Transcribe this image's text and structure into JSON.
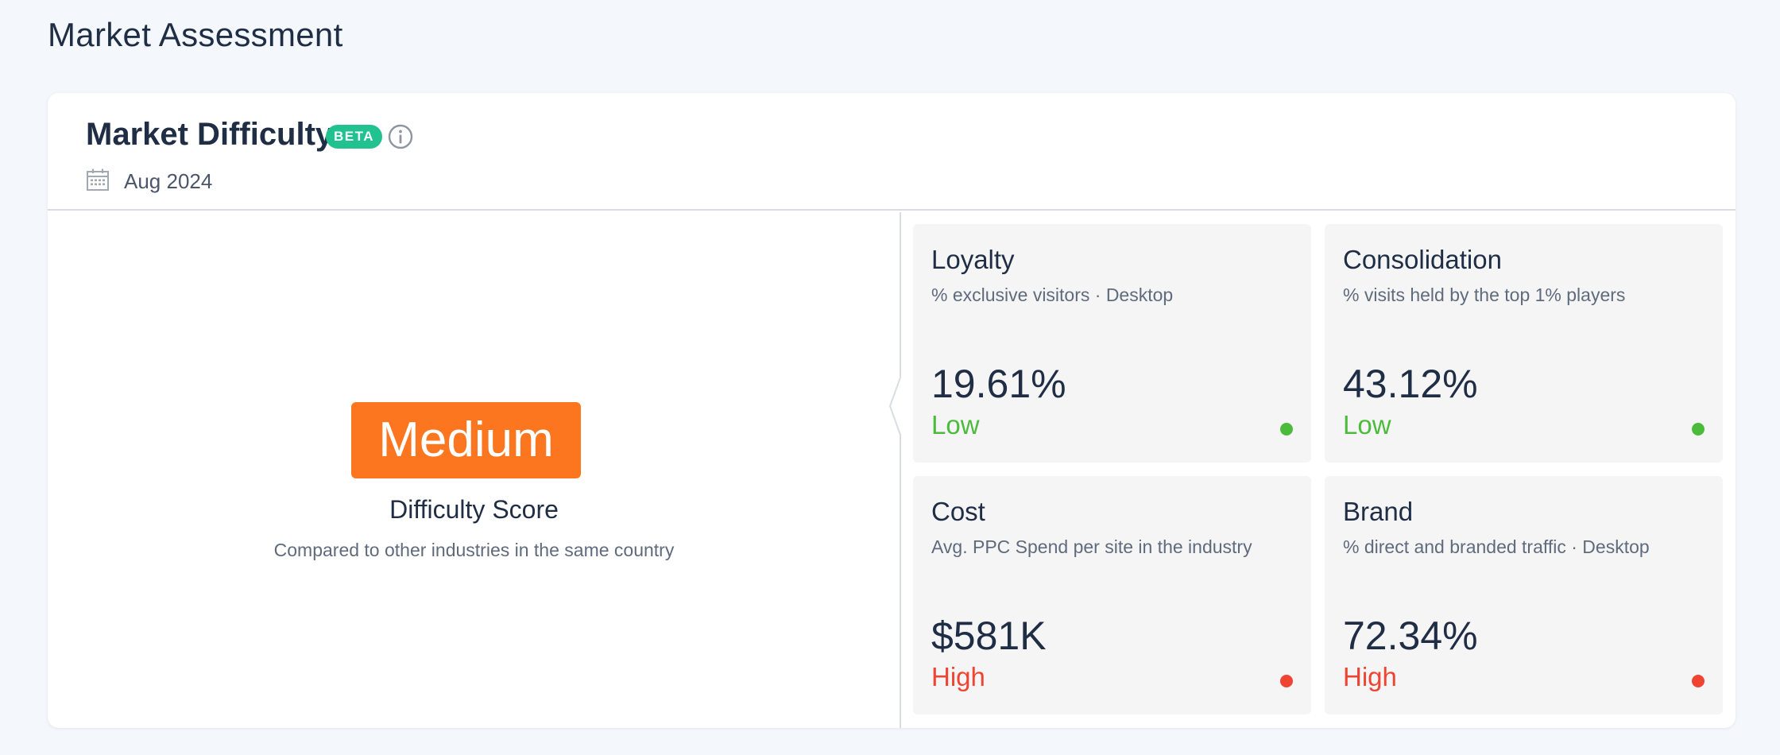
{
  "page": {
    "title": "Market Assessment"
  },
  "card": {
    "title": "Market Difficulty",
    "badge": "BETA",
    "date": "Aug 2024"
  },
  "score": {
    "value": "Medium",
    "title": "Difficulty Score",
    "subtitle": "Compared to other industries in the same country",
    "color": "#fb761e"
  },
  "colors": {
    "low": "#4cbb3c",
    "high": "#f04433",
    "badge": "#21c28f"
  },
  "metrics": [
    {
      "title": "Loyalty",
      "subtitle": "% exclusive visitors · Desktop",
      "value": "19.61%",
      "level": "Low",
      "level_color": "#4cbb3c"
    },
    {
      "title": "Consolidation",
      "subtitle": "% visits held by the top 1% players",
      "value": "43.12%",
      "level": "Low",
      "level_color": "#4cbb3c"
    },
    {
      "title": "Cost",
      "subtitle": "Avg. PPC Spend per site in the industry",
      "value": "$581K",
      "level": "High",
      "level_color": "#f04433"
    },
    {
      "title": "Brand",
      "subtitle": "% direct and branded traffic · Desktop",
      "value": "72.34%",
      "level": "High",
      "level_color": "#f04433"
    }
  ],
  "icons": {
    "info": "info-icon",
    "calendar": "calendar-icon"
  }
}
